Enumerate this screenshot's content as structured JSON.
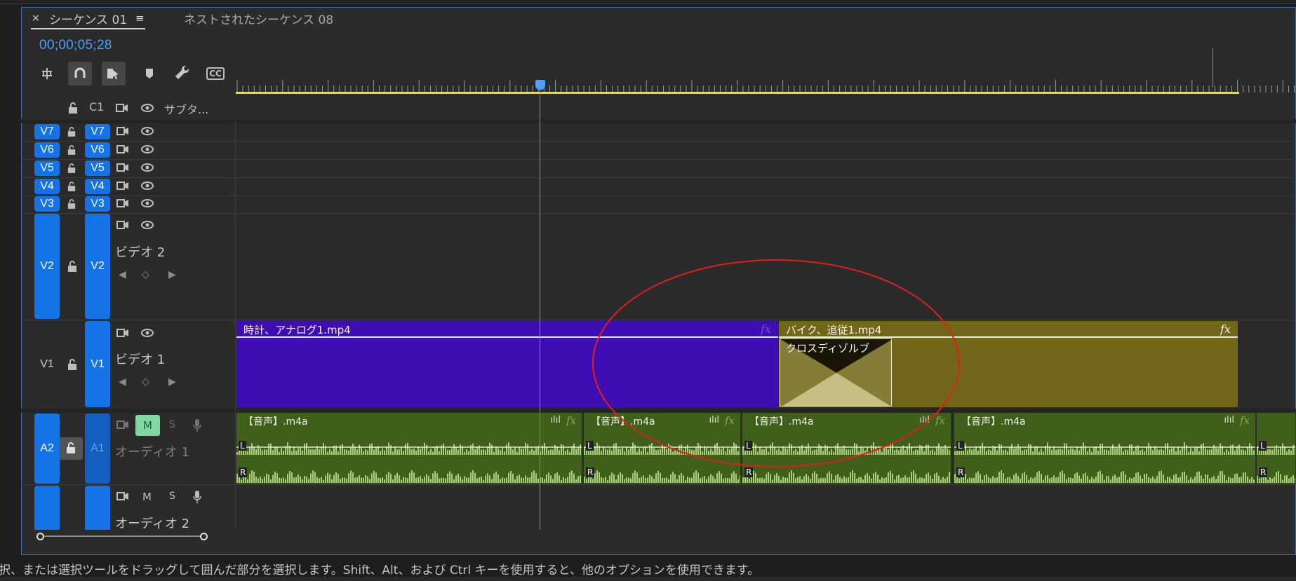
{
  "tabs": {
    "close": "×",
    "active": "シーケンス 01",
    "menu": "≡",
    "second": "ネストされたシーケンス 08"
  },
  "timecode": "00;00;05;28",
  "toolbar": {
    "insert_icon": "insert-sequence-icon",
    "snap_icon": "magnet-snap-icon",
    "linked_icon": "linked-selection-icon",
    "marker_icon": "marker-icon",
    "settings_icon": "wrench-icon",
    "captions_label": "CC"
  },
  "header": {
    "source": "C1",
    "subtitle": "サブタ..."
  },
  "video_tracks": [
    {
      "target": "V7",
      "id": "V7"
    },
    {
      "target": "V6",
      "id": "V6"
    },
    {
      "target": "V5",
      "id": "V5"
    },
    {
      "target": "V4",
      "id": "V4"
    },
    {
      "target": "V3",
      "id": "V3"
    },
    {
      "target": "V2",
      "id": "V2",
      "name": "ビデオ 2"
    },
    {
      "target": "V1",
      "id": "V1",
      "name": "ビデオ 1"
    }
  ],
  "audio_tracks": [
    {
      "target": "A2",
      "id": "A1",
      "name": "オーディオ 1",
      "mute": "M",
      "solo": "S"
    },
    {
      "id": "",
      "name": "オーディオ 2",
      "mute": "M",
      "solo": "S"
    }
  ],
  "video_clips": [
    {
      "title": "時計、アナログ1.mp4",
      "fx": "fx",
      "color": "#3e0db3"
    },
    {
      "title": "バイク、追従1.mp4",
      "fx": "fx",
      "color": "#726719"
    }
  ],
  "transition": {
    "label": "クロスディゾルブ"
  },
  "audio_clips": [
    {
      "title": "【音声】.m4a",
      "fx": "fx"
    },
    {
      "title": "【音声】.m4a",
      "fx": "fx"
    },
    {
      "title": "【音声】.m4a",
      "fx": "fx"
    },
    {
      "title": "【音声】.m4a",
      "fx": "fx"
    }
  ],
  "status_text": "択、または選択ツールをドラッグして囲んだ部分を選択します。Shift、Alt、および Ctrl キーを使用すると、他のオプションを使用できます。",
  "colors": {
    "accent": "#4a9fff",
    "track_button": "#1473e6",
    "work_area": "#e7e31c",
    "annotation": "#e0201c"
  }
}
